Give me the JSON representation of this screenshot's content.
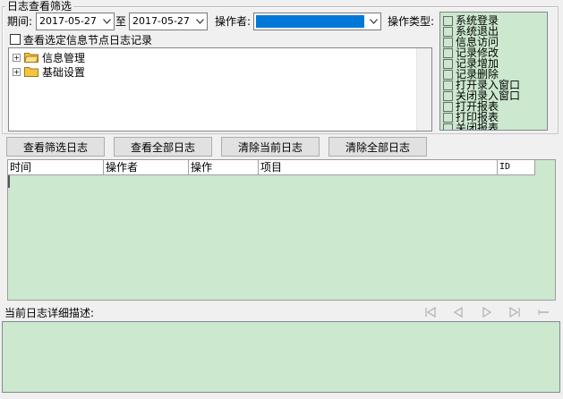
{
  "filter_group": {
    "title": "日志查看筛选",
    "period_label": "期间:",
    "date_from": "2017-05-27",
    "to_label": "至",
    "date_to": "2017-05-27",
    "operator_label": "操作者:",
    "operator_value": "",
    "op_type_label": "操作类型:",
    "node_filter_label": "查看选定信息节点日志记录",
    "node_filter_checked": false
  },
  "tree": {
    "nodes": [
      {
        "label": "信息管理",
        "expanded": false,
        "selected": false
      },
      {
        "label": "基础设置",
        "expanded": false,
        "selected": false
      }
    ]
  },
  "op_types": [
    {
      "label": "系统登录",
      "checked": false
    },
    {
      "label": "系统退出",
      "checked": false
    },
    {
      "label": "信息访问",
      "checked": false
    },
    {
      "label": "记录修改",
      "checked": false
    },
    {
      "label": "记录增加",
      "checked": false
    },
    {
      "label": "记录删除",
      "checked": false
    },
    {
      "label": "打开录入窗口",
      "checked": false
    },
    {
      "label": "关闭录入窗口",
      "checked": false
    },
    {
      "label": "打开报表",
      "checked": false
    },
    {
      "label": "打印报表",
      "checked": false
    },
    {
      "label": "关闭报表",
      "checked": false
    }
  ],
  "buttons": {
    "view_filtered": "查看筛选日志",
    "view_all": "查看全部日志",
    "clear_current": "清除当前日志",
    "clear_all": "清除全部日志"
  },
  "grid": {
    "columns": [
      "时间",
      "操作者",
      "操作",
      "项目",
      "ID"
    ],
    "rows": []
  },
  "detail": {
    "label": "当前日志详细描述:",
    "text": ""
  },
  "nav_icons": [
    "first-record-icon",
    "prev-record-icon",
    "next-record-icon",
    "last-record-icon",
    "dash-icon"
  ],
  "colors": {
    "list_bg": "#cce8cf",
    "selection": "#0078d7",
    "window_bg": "#f0f0f0",
    "folder": "#f5c542"
  }
}
